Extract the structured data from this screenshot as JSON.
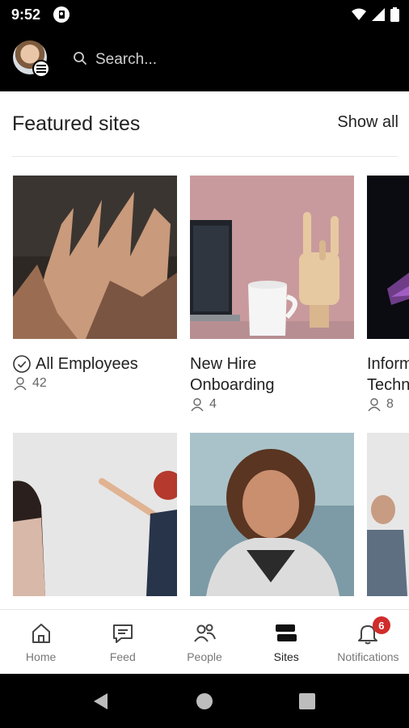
{
  "status": {
    "time": "9:52"
  },
  "header": {
    "search_placeholder": "Search..."
  },
  "featured": {
    "title": "Featured sites",
    "show_all": "Show all"
  },
  "sites": [
    {
      "title": "All Employees",
      "members": "42",
      "following": true
    },
    {
      "title_line1": "New Hire",
      "title_line2": "Onboarding",
      "members": "4"
    },
    {
      "title_line1": "Inform",
      "title_line2": "Techn",
      "members": "8"
    }
  ],
  "nav": {
    "home": "Home",
    "feed": "Feed",
    "people": "People",
    "sites": "Sites",
    "notifications": "Notifications",
    "notifications_badge": "6"
  },
  "colors": {
    "badge": "#d12c2c",
    "background": "#ffffff",
    "header": "#000000"
  }
}
